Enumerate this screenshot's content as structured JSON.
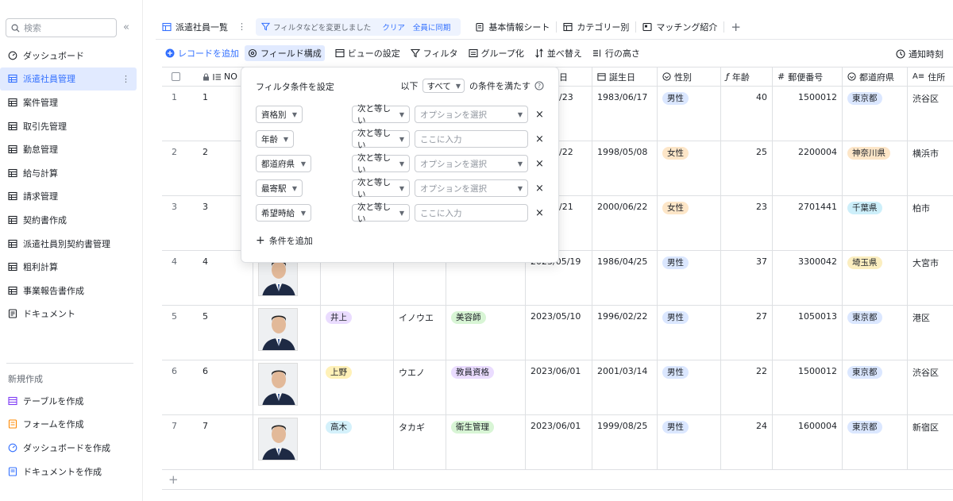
{
  "sidebar": {
    "search_placeholder": "検索",
    "collapse_icon": "«",
    "items": [
      {
        "label": "ダッシュボード",
        "icon": "dashboard-icon"
      },
      {
        "label": "派遣社員管理",
        "icon": "table-icon",
        "active": true
      },
      {
        "label": "案件管理",
        "icon": "table-icon"
      },
      {
        "label": "取引先管理",
        "icon": "table-icon"
      },
      {
        "label": "勤怠管理",
        "icon": "table-icon"
      },
      {
        "label": "給与計算",
        "icon": "table-icon"
      },
      {
        "label": "請求管理",
        "icon": "table-icon"
      },
      {
        "label": "契約書作成",
        "icon": "table-icon"
      },
      {
        "label": "派遣社員別契約書管理",
        "icon": "table-icon"
      },
      {
        "label": "粗利計算",
        "icon": "table-icon"
      },
      {
        "label": "事業報告書作成",
        "icon": "table-icon"
      },
      {
        "label": "ドキュメント",
        "icon": "doc-icon"
      }
    ],
    "create_label": "新規作成",
    "create_items": [
      {
        "label": "テーブルを作成",
        "color": "#7f3bf5"
      },
      {
        "label": "フォームを作成",
        "color": "#ff8800"
      },
      {
        "label": "ダッシュボードを作成",
        "color": "#3370ff"
      },
      {
        "label": "ドキュメントを作成",
        "color": "#3370ff"
      }
    ]
  },
  "tabs": {
    "active": "派遣社員一覧",
    "filter_changed": "フィルタなどを変更しました",
    "clear": "クリア",
    "sync": "全員に同期",
    "others": [
      "基本情報シート",
      "カテゴリー別",
      "マッチング紹介"
    ]
  },
  "toolbar": {
    "add_record": "レコードを追加",
    "field_config": "フィールド構成",
    "view_settings": "ビューの設定",
    "filter": "フィルタ",
    "group": "グループ化",
    "sort": "並べ替え",
    "row_height": "行の高さ",
    "notify_time": "通知時刻"
  },
  "columns": {
    "no": "NO",
    "birthday": "誕生日",
    "gender": "性別",
    "age": "年齢",
    "zip": "郵便番号",
    "prefecture": "都道府県",
    "address": "住所",
    "partial_date_header": "日"
  },
  "rows": [
    {
      "idx": "1",
      "no": "1",
      "name": "",
      "kana": "",
      "qual": "",
      "date": "/23",
      "birthday": "1983/06/17",
      "gender": "男性",
      "age": "40",
      "zip": "1500012",
      "pref": "東京都",
      "addr": "渋谷区"
    },
    {
      "idx": "2",
      "no": "2",
      "name": "",
      "kana": "",
      "qual": "",
      "date": "/22",
      "birthday": "1998/05/08",
      "gender": "女性",
      "age": "25",
      "zip": "2200004",
      "pref": "神奈川県",
      "addr": "横浜市"
    },
    {
      "idx": "3",
      "no": "3",
      "name": "",
      "kana": "",
      "qual": "",
      "date": "/21",
      "birthday": "2000/06/22",
      "gender": "女性",
      "age": "23",
      "zip": "2701441",
      "pref": "千葉県",
      "addr": "柏市"
    },
    {
      "idx": "4",
      "no": "4",
      "name": "",
      "kana": "",
      "qual": "",
      "date": "2023/05/19",
      "birthday": "1986/04/25",
      "gender": "男性",
      "age": "37",
      "zip": "3300042",
      "pref": "埼玉県",
      "addr": "大宮市"
    },
    {
      "idx": "5",
      "no": "5",
      "name": "井上",
      "kana": "イノウエ",
      "qual": "美容師",
      "date": "2023/05/10",
      "birthday": "1996/02/22",
      "gender": "男性",
      "age": "27",
      "zip": "1050013",
      "pref": "東京都",
      "addr": "港区"
    },
    {
      "idx": "6",
      "no": "6",
      "name": "上野",
      "kana": "ウエノ",
      "qual": "教員資格",
      "date": "2023/06/01",
      "birthday": "2001/03/14",
      "gender": "男性",
      "age": "22",
      "zip": "1500012",
      "pref": "東京都",
      "addr": "渋谷区"
    },
    {
      "idx": "7",
      "no": "7",
      "name": "高木",
      "kana": "タカギ",
      "qual": "衛生管理",
      "date": "2023/06/01",
      "birthday": "1999/08/25",
      "gender": "男性",
      "age": "24",
      "zip": "1600004",
      "pref": "東京都",
      "addr": "新宿区"
    }
  ],
  "filter_popup": {
    "title": "フィルタ条件を設定",
    "cond_prefix": "以下",
    "cond_select": "すべて",
    "cond_suffix": "の条件を満たす",
    "rows": [
      {
        "field": "資格別",
        "op": "次と等しい",
        "value": "オプションを選択",
        "kind": "select"
      },
      {
        "field": "年齢",
        "op": "次と等しい",
        "value": "ここに入力",
        "kind": "input"
      },
      {
        "field": "都道府県",
        "op": "次と等しい",
        "value": "オプションを選択",
        "kind": "select"
      },
      {
        "field": "最寄駅",
        "op": "次と等しい",
        "value": "オプションを選択",
        "kind": "select"
      },
      {
        "field": "希望時給",
        "op": "次と等しい",
        "value": "ここに入力",
        "kind": "input"
      }
    ],
    "add_condition": "条件を追加"
  },
  "colors": {
    "accent": "#3370ff",
    "male_tag": "#dbe7ff",
    "female_tag": "#fde6c8",
    "tokyo_tag": "#dbe7ff",
    "kanagawa_tag": "#fde6c8",
    "chiba_tag": "#cdeffa",
    "saitama_tag": "#fbeec0",
    "name_inoue": "#eadcff",
    "name_ueno": "#fff1b8",
    "name_takagi": "#d4f1fb",
    "qual_green": "#d8f5d5",
    "qual_purple": "#eadcff"
  }
}
